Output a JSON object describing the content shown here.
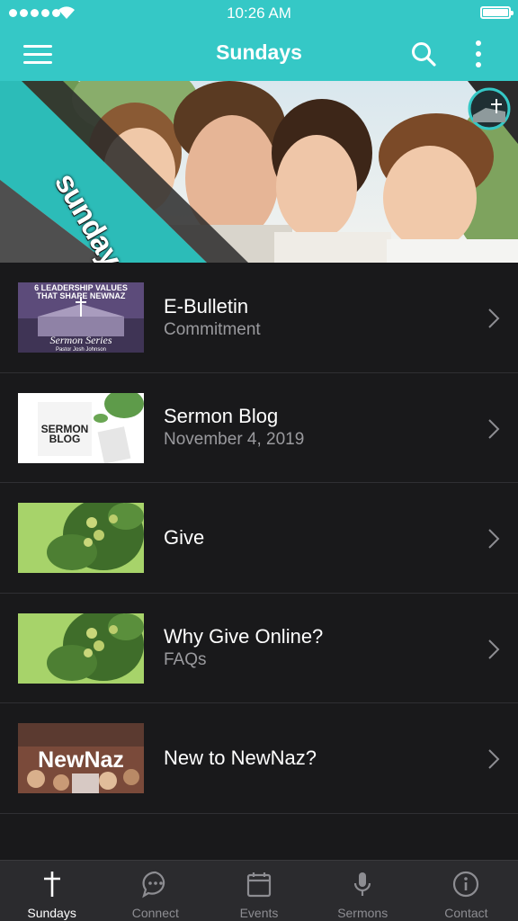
{
  "status_bar": {
    "time": "10:26 AM"
  },
  "header": {
    "title": "Sundays"
  },
  "hero": {
    "label": "sundays"
  },
  "items": [
    {
      "title": "E-Bulletin",
      "subtitle": "Commitment",
      "thumb_lines": [
        "6 LEADERSHIP VALUES",
        "THAT SHAPE NEWNAZ",
        "Sermon Series",
        "Pastor Josh Johnson"
      ]
    },
    {
      "title": "Sermon Blog",
      "subtitle": "November 4, 2019",
      "thumb_lines": [
        "SERMON",
        "BLOG"
      ]
    },
    {
      "title": "Give",
      "subtitle": ""
    },
    {
      "title": "Why Give Online?",
      "subtitle": "FAQs"
    },
    {
      "title": "New to NewNaz?",
      "subtitle": "",
      "thumb_lines": [
        "NewNaz"
      ]
    }
  ],
  "tabs": [
    {
      "label": "Sundays",
      "icon": "cross-icon",
      "active": true
    },
    {
      "label": "Connect",
      "icon": "chat-icon",
      "active": false
    },
    {
      "label": "Events",
      "icon": "calendar-icon",
      "active": false
    },
    {
      "label": "Sermons",
      "icon": "microphone-icon",
      "active": false
    },
    {
      "label": "Contact",
      "icon": "info-icon",
      "active": false
    }
  ],
  "colors": {
    "brand_teal": "#35c8c6",
    "list_background": "#19191b",
    "tab_bar": "#2b2b2e",
    "secondary_text": "#9a9a9e"
  }
}
